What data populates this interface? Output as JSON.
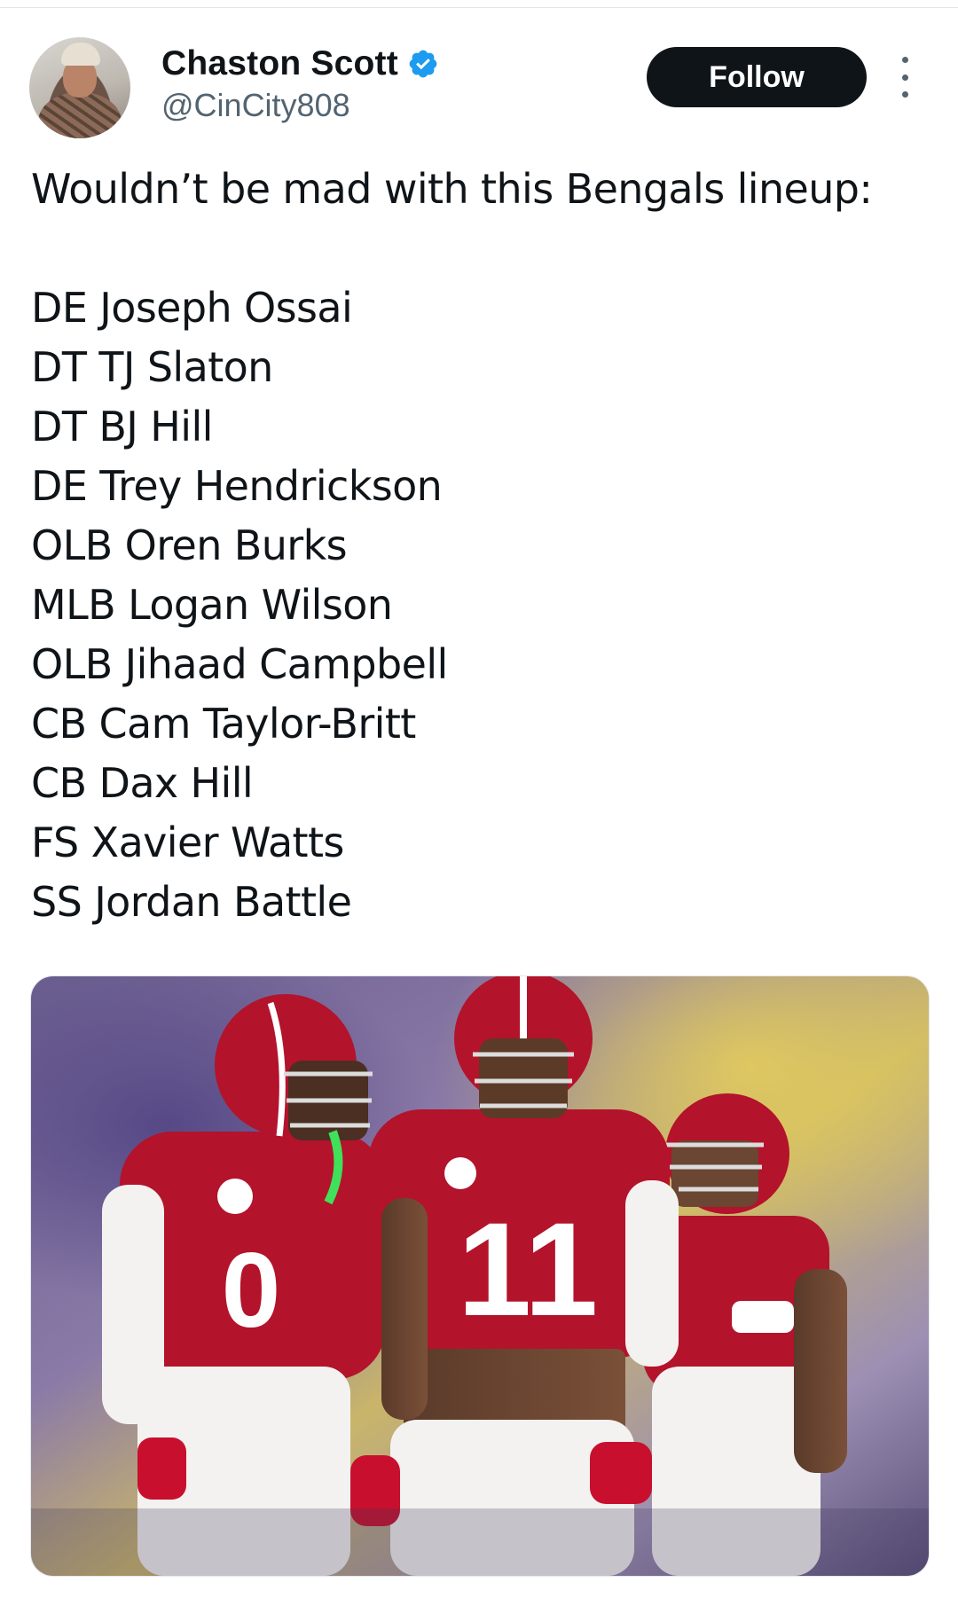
{
  "tweet": {
    "author": {
      "display_name": "Chaston Scott",
      "handle": "@CinCity808",
      "verified": true,
      "verified_color": "#1d9bf0"
    },
    "follow_label": "Follow",
    "text_intro": "Wouldn’t be mad with this Bengals lineup:",
    "lineup": [
      "DE Joseph Ossai",
      "DT TJ Slaton",
      "DT BJ Hill",
      "DE Trey Hendrickson",
      "OLB Oren Burks",
      "MLB Logan Wilson",
      "OLB Jihaad Campbell",
      "CB Cam Taylor-Britt",
      "CB Dax Hill",
      "FS Xavier Watts",
      "SS Jordan Battle"
    ],
    "media": {
      "jersey_numbers": [
        "0",
        "11"
      ],
      "colors": {
        "crimson": "#b3132b",
        "white": "#f4f2f0"
      }
    }
  },
  "icons": {
    "verified": "verified-badge-icon",
    "more": "more-options-icon"
  }
}
